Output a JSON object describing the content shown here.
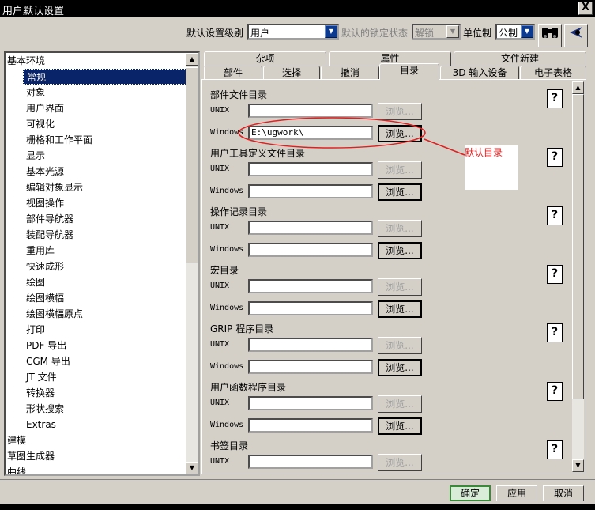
{
  "window": {
    "title": "用户默认设置",
    "close": "X"
  },
  "toolbar": {
    "level_label": "默认设置级别",
    "level_value": "用户",
    "lock_label": "默认的锁定状态",
    "lock_value": "解锁",
    "unit_label": "单位制",
    "unit_value": "公制"
  },
  "tree": {
    "top": "基本环境",
    "children": [
      "常规",
      "对象",
      "用户界面",
      "可视化",
      "栅格和工作平面",
      "显示",
      "基本光源",
      "编辑对象显示",
      "视图操作",
      "部件导航器",
      "装配导航器",
      "重用库",
      "快速成形",
      "绘图",
      "绘图横幅",
      "绘图横幅原点",
      "打印",
      "PDF 导出",
      "CGM 导出",
      "JT 文件",
      "转换器",
      "形状搜索",
      "Extras"
    ],
    "after": [
      "建模",
      "草图生成器",
      "曲线"
    ]
  },
  "tabs": {
    "row1": [
      "杂项",
      "属性",
      "文件新建"
    ],
    "row2": [
      "部件",
      "选择",
      "撤消",
      "目录",
      "3D 输入设备",
      "电子表格"
    ],
    "active": "目录"
  },
  "panel": {
    "sections": [
      {
        "title": "部件文件目录",
        "unix": "",
        "windows": "E:\\ugwork\\"
      },
      {
        "title": "用户工具定义文件目录",
        "unix": "",
        "windows": ""
      },
      {
        "title": "操作记录目录",
        "unix": "",
        "windows": ""
      },
      {
        "title": "宏目录",
        "unix": "",
        "windows": ""
      },
      {
        "title": "GRIP 程序目录",
        "unix": "",
        "windows": ""
      },
      {
        "title": "用户函数程序目录",
        "unix": "",
        "windows": ""
      },
      {
        "title": "书签目录",
        "unix": "",
        "windows": ""
      }
    ],
    "unix_label": "UNIX",
    "windows_label": "Windows",
    "browse_label": "浏览...",
    "help_label": "?"
  },
  "annotation": {
    "text": "默认目录",
    "color": "#e02020"
  },
  "buttons": {
    "ok": "确定",
    "apply": "应用",
    "cancel": "取消"
  }
}
